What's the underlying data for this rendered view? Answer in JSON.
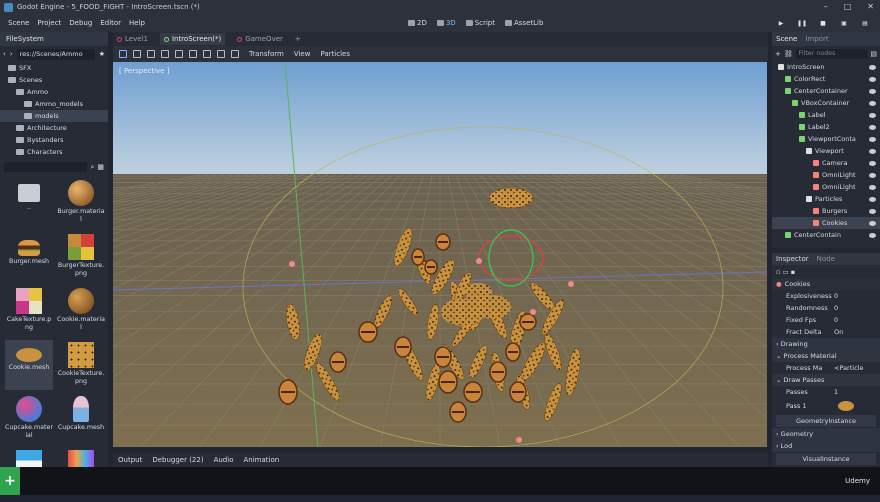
{
  "window": {
    "title": "Godot Engine - 5_FOOD_FIGHT - IntroScreen.tscn (*)"
  },
  "menu": {
    "items": [
      "Scene",
      "Project",
      "Debug",
      "Editor",
      "Help"
    ]
  },
  "workspaces": [
    {
      "label": "2D",
      "active": false
    },
    {
      "label": "3D",
      "active": true
    },
    {
      "label": "Script",
      "active": false
    },
    {
      "label": "AssetLib",
      "active": false
    }
  ],
  "filesystem": {
    "tab": "FileSystem",
    "path": "res://Scenes/Ammo",
    "tree": [
      {
        "label": "SFX",
        "depth": 1,
        "selected": false
      },
      {
        "label": "Scenes",
        "depth": 1,
        "selected": false
      },
      {
        "label": "Ammo",
        "depth": 2,
        "selected": false
      },
      {
        "label": "Ammo_models",
        "depth": 3,
        "selected": false
      },
      {
        "label": "models",
        "depth": 3,
        "selected": true
      },
      {
        "label": "Architecture",
        "depth": 2,
        "selected": false
      },
      {
        "label": "Bystanders",
        "depth": 2,
        "selected": false
      },
      {
        "label": "Characters",
        "depth": 2,
        "selected": false
      }
    ],
    "files": [
      {
        "label": "..",
        "kind": "folder",
        "selected": false
      },
      {
        "label": "Burger.material",
        "kind": "material-burger",
        "selected": false
      },
      {
        "label": "Burger.mesh",
        "kind": "mesh-burger",
        "selected": false
      },
      {
        "label": "BurgerTexture.png",
        "kind": "tex-burger",
        "selected": false
      },
      {
        "label": "CakeTexture.png",
        "kind": "tex-cake",
        "selected": false
      },
      {
        "label": "Cookie.material",
        "kind": "material-cookie",
        "selected": false
      },
      {
        "label": "Cookie.mesh",
        "kind": "mesh-cookie",
        "selected": true
      },
      {
        "label": "CookieTexture.png",
        "kind": "tex-cookie",
        "selected": false
      },
      {
        "label": "Cupcake.material",
        "kind": "material-cupcake",
        "selected": false
      },
      {
        "label": "Cupcake.mesh",
        "kind": "mesh-cupcake",
        "selected": false
      },
      {
        "label": "",
        "kind": "tex-cupcake",
        "selected": false
      },
      {
        "label": "",
        "kind": "tex-stripes",
        "selected": false
      }
    ]
  },
  "editor_tabs": [
    {
      "label": "Level1",
      "active": false
    },
    {
      "label": "IntroScreen(*)",
      "active": true
    },
    {
      "label": "GameOver",
      "active": false
    }
  ],
  "toolbar": {
    "transform": "Transform",
    "view": "View",
    "particles": "Particles"
  },
  "viewport": {
    "label": "[ Perspective ]"
  },
  "bottom_tabs": [
    "Output",
    "Debugger (22)",
    "Audio",
    "Animation"
  ],
  "scene": {
    "tab": "Scene",
    "tab2": "Import",
    "filter_placeholder": "Filter nodes",
    "nodes": [
      {
        "label": "IntroScreen",
        "depth": 0,
        "color": "#e0e0e0",
        "selected": false
      },
      {
        "label": "ColorRect",
        "depth": 1,
        "color": "#7bd46e",
        "selected": false
      },
      {
        "label": "CenterContainer",
        "depth": 1,
        "color": "#7bd46e",
        "selected": false
      },
      {
        "label": "VBoxContainer",
        "depth": 2,
        "color": "#7bd46e",
        "selected": false
      },
      {
        "label": "Label",
        "depth": 3,
        "color": "#7bd46e",
        "selected": false
      },
      {
        "label": "Label2",
        "depth": 3,
        "color": "#7bd46e",
        "selected": false
      },
      {
        "label": "ViewportConta",
        "depth": 3,
        "color": "#7bd46e",
        "selected": false
      },
      {
        "label": "Viewport",
        "depth": 4,
        "color": "#e0e0e0",
        "selected": false
      },
      {
        "label": "Camera",
        "depth": 5,
        "color": "#fc7f7f",
        "selected": false
      },
      {
        "label": "OmniLight",
        "depth": 5,
        "color": "#fc7f7f",
        "selected": false
      },
      {
        "label": "OmniLight",
        "depth": 5,
        "color": "#fc7f7f",
        "selected": false
      },
      {
        "label": "Particles",
        "depth": 4,
        "color": "#e0e0e0",
        "selected": false
      },
      {
        "label": "Burgers",
        "depth": 5,
        "color": "#fc7f7f",
        "selected": false
      },
      {
        "label": "Cookies",
        "depth": 5,
        "color": "#fc7f7f",
        "selected": true
      },
      {
        "label": "CenterContain",
        "depth": 1,
        "color": "#7bd46e",
        "selected": false
      }
    ]
  },
  "inspector": {
    "tab": "Inspector",
    "tab2": "Node",
    "object": "Cookies",
    "props": [
      {
        "name": "Explosiveness",
        "value": "0"
      },
      {
        "name": "Randomness",
        "value": "0"
      },
      {
        "name": "Fixed Fps",
        "value": "0"
      },
      {
        "name": "Fract Delta",
        "value": "On"
      }
    ],
    "drawing": "Drawing",
    "process_material": "Process Material",
    "process_row": {
      "name": "Process Ma",
      "value": "<Particle"
    },
    "draw_passes": "Draw Passes",
    "passes": {
      "name": "Passes",
      "value": "1"
    },
    "pass1": "Pass 1",
    "geometry_instance": "GeometryInstance",
    "geometry": "Geometry",
    "lod": "Lod",
    "visual_instance": "VisualInstance"
  },
  "statusbar": {
    "brand": "Udemy"
  },
  "colors": {
    "accent": "#8ab4f8",
    "sky_top": "#7aa9d8",
    "ground": "#7b6e52"
  }
}
